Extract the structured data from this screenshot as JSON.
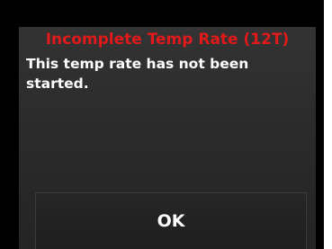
{
  "dialog": {
    "title": "Incomplete Temp Rate (12T)",
    "message": "This temp rate has not been started.",
    "ok_label": "OK"
  },
  "colors": {
    "title": "#e01a1a",
    "text": "#ffffff",
    "background": "#2b2b2b",
    "bezel": "#000000"
  }
}
